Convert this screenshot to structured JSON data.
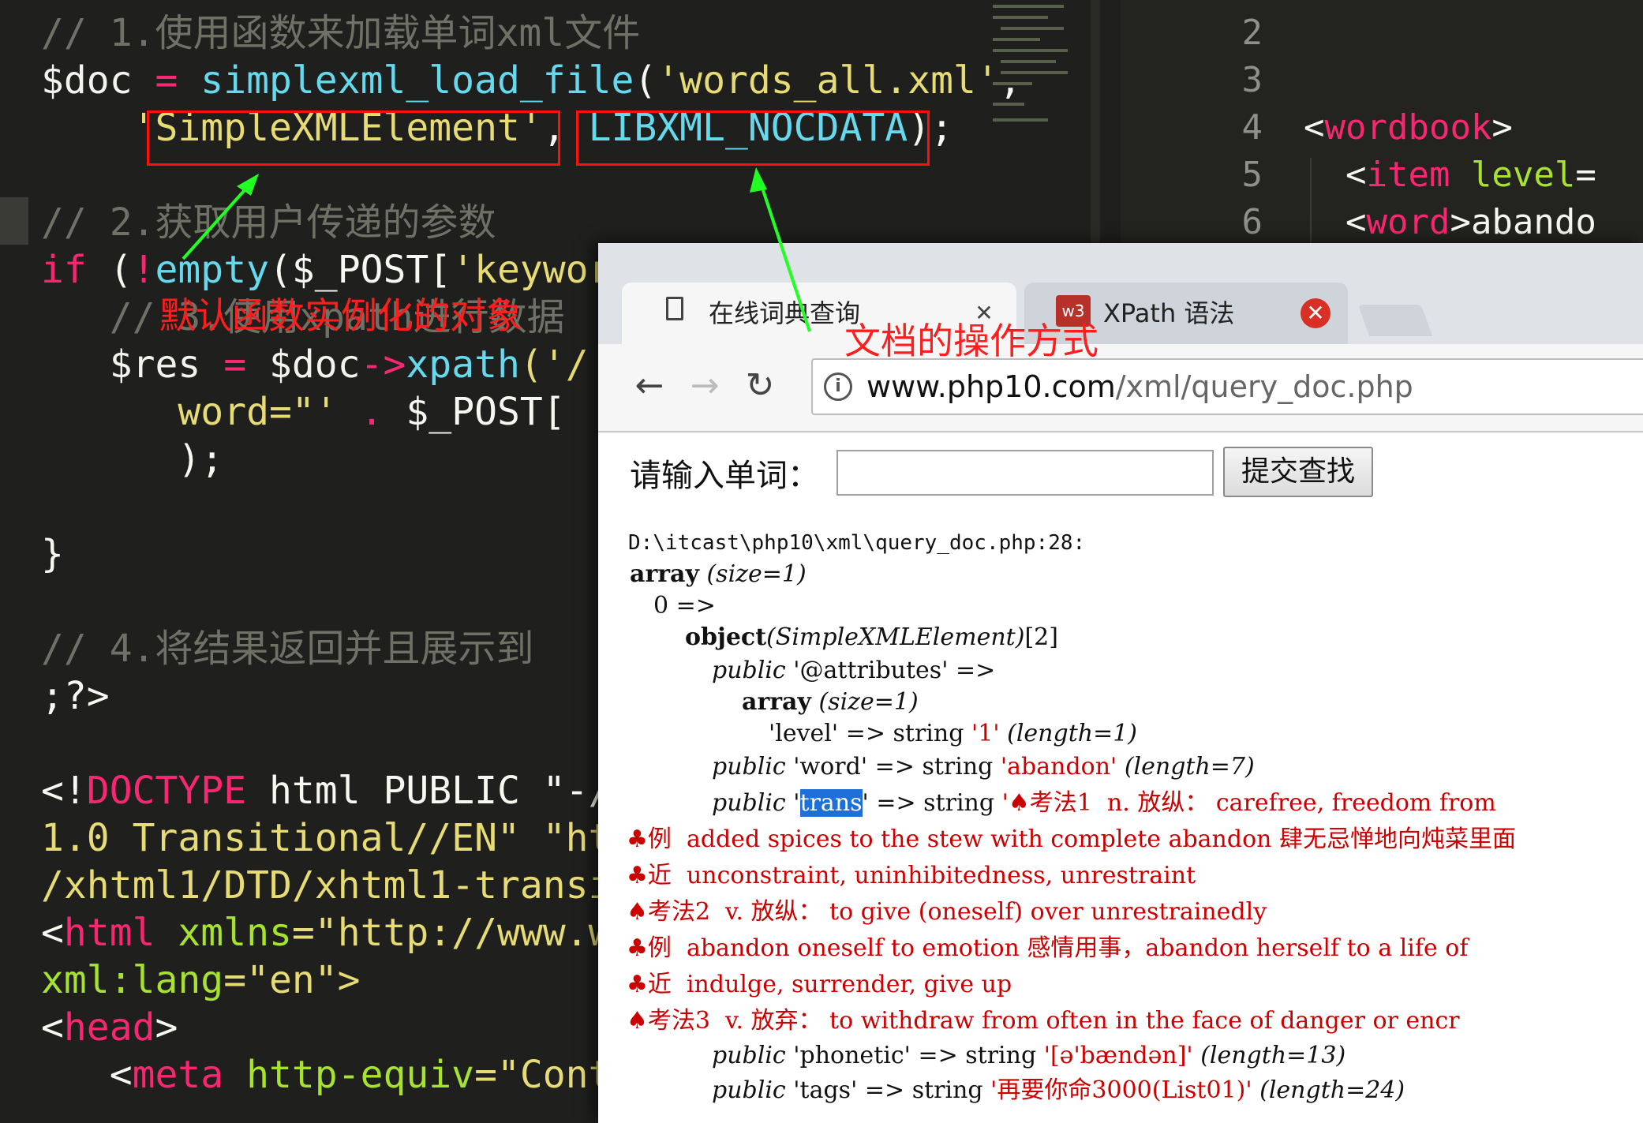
{
  "editor": {
    "lines": [
      {
        "segments": [
          {
            "t": "// 1.使用函数来加载单词xml文件",
            "c": "c-comment"
          }
        ]
      },
      {
        "segments": [
          {
            "t": "$doc",
            "c": "c-var"
          },
          {
            "t": " = ",
            "c": "c-op"
          },
          {
            "t": "simplexml_load_file",
            "c": "c-fn"
          },
          {
            "t": "(",
            "c": "c-plain"
          },
          {
            "t": "'words_all.xml'",
            "c": "c-str"
          },
          {
            "t": ",",
            "c": "c-plain"
          }
        ]
      },
      {
        "segments": [
          {
            "t": "    ",
            "c": "c-plain"
          },
          {
            "t": "'SimpleXMLElement'",
            "c": "c-str"
          },
          {
            "t": ", ",
            "c": "c-plain"
          },
          {
            "t": "LIBXML_NOCDATA",
            "c": "c-fn"
          },
          {
            "t": ");",
            "c": "c-plain"
          }
        ]
      },
      {
        "segments": [
          {
            "t": "",
            "c": "c-plain"
          }
        ]
      },
      {
        "segments": [
          {
            "t": "// 2.获取用户传递的参数",
            "c": "c-comment"
          }
        ]
      },
      {
        "segments": [
          {
            "t": "if",
            "c": "c-op"
          },
          {
            "t": " (",
            "c": "c-plain"
          },
          {
            "t": "!",
            "c": "c-op"
          },
          {
            "t": "empty",
            "c": "c-fn"
          },
          {
            "t": "($_POST[",
            "c": "c-plain"
          },
          {
            "t": "'keywor",
            "c": "c-str"
          }
        ]
      },
      {
        "segments": [
          {
            "t": "   // 3.使用xpath进行数据",
            "c": "c-comment"
          }
        ]
      },
      {
        "segments": [
          {
            "t": "   $res",
            "c": "c-var"
          },
          {
            "t": " = ",
            "c": "c-op"
          },
          {
            "t": "$doc",
            "c": "c-var"
          },
          {
            "t": "->",
            "c": "c-op"
          },
          {
            "t": "xpath",
            "c": "c-fn"
          },
          {
            "t": "('/",
            "c": "c-str"
          }
        ]
      },
      {
        "segments": [
          {
            "t": "      word=\"'",
            "c": "c-str"
          },
          {
            "t": " . ",
            "c": "c-op"
          },
          {
            "t": "$_POST[",
            "c": "c-plain"
          }
        ]
      },
      {
        "segments": [
          {
            "t": "      );",
            "c": "c-plain"
          }
        ]
      },
      {
        "segments": [
          {
            "t": "",
            "c": "c-plain"
          }
        ]
      },
      {
        "segments": [
          {
            "t": "}",
            "c": "c-plain"
          }
        ]
      },
      {
        "segments": [
          {
            "t": "",
            "c": "c-plain"
          }
        ]
      },
      {
        "segments": [
          {
            "t": "// 4.将结果返回并且展示到",
            "c": "c-comment"
          }
        ]
      },
      {
        "segments": [
          {
            "t": ";?>",
            "c": "c-plain"
          }
        ]
      },
      {
        "segments": [
          {
            "t": "",
            "c": "c-plain"
          }
        ]
      },
      {
        "segments": [
          {
            "t": "<!",
            "c": "c-plain"
          },
          {
            "t": "DOCTYPE",
            "c": "c-tag"
          },
          {
            "t": " html PUBLIC \"-//",
            "c": "c-plain"
          }
        ]
      },
      {
        "segments": [
          {
            "t": "1.0 Transitional//EN\" \"htt",
            "c": "c-str"
          }
        ]
      },
      {
        "segments": [
          {
            "t": "/xhtml1/DTD/xhtml1-transit",
            "c": "c-str"
          }
        ]
      },
      {
        "segments": [
          {
            "t": "<",
            "c": "c-plain"
          },
          {
            "t": "html",
            "c": "c-tag"
          },
          {
            "t": " xmlns",
            "c": "c-attr"
          },
          {
            "t": "=\"http://www.w",
            "c": "c-str"
          }
        ]
      },
      {
        "segments": [
          {
            "t": "xml:lang",
            "c": "c-attr"
          },
          {
            "t": "=\"en\">",
            "c": "c-str"
          }
        ]
      },
      {
        "segments": [
          {
            "t": "<",
            "c": "c-plain"
          },
          {
            "t": "head",
            "c": "c-tag"
          },
          {
            "t": ">",
            "c": "c-plain"
          }
        ]
      },
      {
        "segments": [
          {
            "t": "   <",
            "c": "c-plain"
          },
          {
            "t": "meta",
            "c": "c-tag"
          },
          {
            "t": " http-equiv",
            "c": "c-attr"
          },
          {
            "t": "=\"Cont",
            "c": "c-str"
          }
        ]
      }
    ]
  },
  "right_pane": {
    "line_numbers": [
      "2",
      "3",
      "4",
      "5",
      "6"
    ],
    "code": [
      {
        "segments": [
          {
            "t": "",
            "c": "c-plain"
          }
        ]
      },
      {
        "segments": [
          {
            "t": "",
            "c": "c-plain"
          }
        ]
      },
      {
        "segments": [
          {
            "t": "<",
            "c": "c-plain"
          },
          {
            "t": "wordbook",
            "c": "c-tag"
          },
          {
            "t": ">",
            "c": "c-plain"
          }
        ]
      },
      {
        "segments": [
          {
            "t": "  <",
            "c": "c-plain"
          },
          {
            "t": "item",
            "c": "c-tag"
          },
          {
            "t": " level",
            "c": "c-attr"
          },
          {
            "t": "=",
            "c": "c-plain"
          }
        ]
      },
      {
        "segments": [
          {
            "t": "  <",
            "c": "c-plain"
          },
          {
            "t": "word",
            "c": "c-tag"
          },
          {
            "t": ">abando",
            "c": "c-plain"
          }
        ]
      }
    ]
  },
  "annotations": {
    "default_object": "默认函数实例化的对象",
    "doc_operation": "文档的操作方式"
  },
  "browser": {
    "tabs": [
      {
        "title": "在线词典查询",
        "active": true
      },
      {
        "title": "XPath 语法",
        "active": false
      }
    ],
    "tab_close_glyph": "✕",
    "w3_label": "w3",
    "nav": {
      "back": "←",
      "forward": "→",
      "reload": "↻"
    },
    "url_host": "www.php10.com",
    "url_path": "/xml/query_doc.php",
    "form": {
      "label": "请输入单词：",
      "input_value": "",
      "submit": "提交查找"
    },
    "dump": {
      "path": "D:\\itcast\\php10\\xml\\query_doc.php:28:",
      "array_kw": "array",
      "size1": "(size=1)",
      "idx0": "0 =>",
      "object_kw": "object",
      "object_cls": "(SimpleXMLElement)",
      "object_id": "[2]",
      "public_kw": "public",
      "attributes_key": "'@attributes'",
      "arrow": "=>",
      "level_key": "'level'",
      "string_kw": "string",
      "level_val": "'1'",
      "length1": "(length=1)",
      "word_key": "'word'",
      "word_val": "'abandon'",
      "length7": "(length=7)",
      "trans_key_pre": "'",
      "trans_key_sel": "trans",
      "trans_key_post": "'",
      "trans_val_1": "'♠考法1  n. 放纵： carefree, freedom from",
      "trans_l2": "♣例  added spices to the stew with complete abandon 肆无忌惮地向炖菜里面",
      "trans_l3": "♣近  unconstraint, uninhibitedness, unrestraint",
      "trans_l4": "♠考法2  v. 放纵： to give (oneself) over unrestrainedly",
      "trans_l5": "♣例  abandon oneself to emotion 感情用事，abandon herself to a life of",
      "trans_l6": "♣近  indulge, surrender, give up",
      "trans_l7": "♠考法3  v. 放弃： to withdraw from often in the face of danger or encr",
      "phonetic_key": "'phonetic'",
      "phonetic_val": "'[ə'bændən]'",
      "length13": "(length=13)",
      "tags_key": "'tags'",
      "tags_val": "'再要你命3000(List01)'",
      "length24": "(length=24)"
    }
  }
}
